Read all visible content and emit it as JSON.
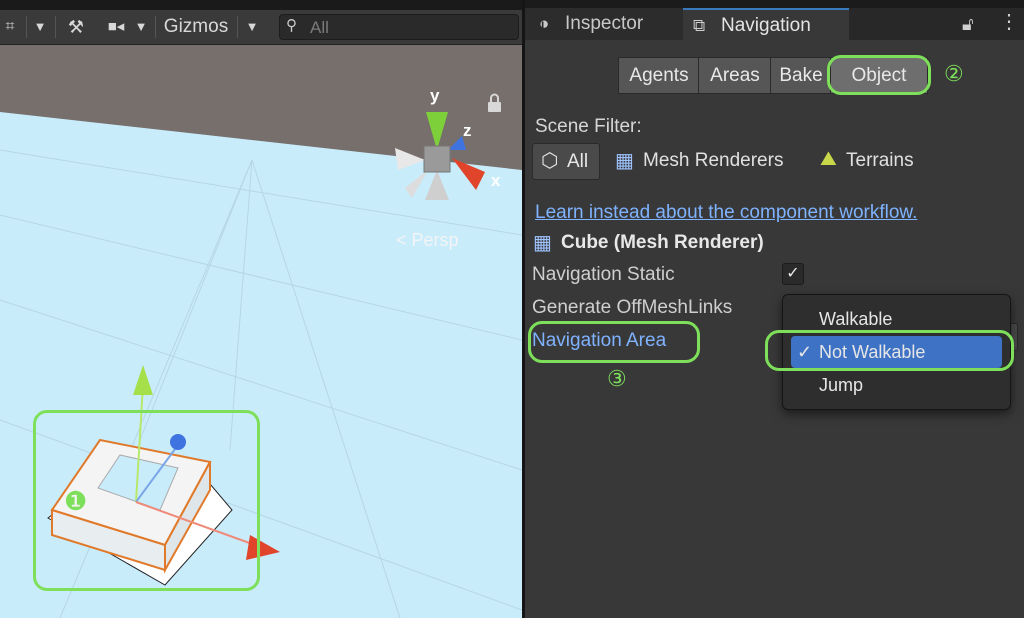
{
  "scene": {
    "toolbar": {
      "gizmos_label": "Gizmos",
      "search_placeholder": "All"
    },
    "persp_label": "< Persp",
    "axis_labels": {
      "x": "x",
      "y": "y",
      "z": "z"
    },
    "callout_number": "❶"
  },
  "panel": {
    "tabs": {
      "inspector": "Inspector",
      "navigation": "Navigation"
    },
    "segments": [
      "Agents",
      "Areas",
      "Bake",
      "Object"
    ],
    "callout_2": "②",
    "scene_filter": {
      "label": "Scene Filter:",
      "all": "All",
      "mesh_renderers": "Mesh Renderers",
      "terrains": "Terrains"
    },
    "learn_link": "Learn instead about the component workflow.",
    "object_title": "Cube (Mesh Renderer)",
    "navigation_static": {
      "label": "Navigation Static",
      "checked": true
    },
    "generate_offmeshlinks": "Generate OffMeshLinks",
    "navigation_area_label": "Navigation Area",
    "callout_3": "③",
    "area_options": [
      "Walkable",
      "Not Walkable",
      "Jump"
    ],
    "area_selected": "Not Walkable",
    "check_mark": "✓"
  },
  "colors": {
    "callout": "#7ee05a",
    "link": "#7fb2ff",
    "selected": "#3e72c4",
    "sky": "#c9ecfb",
    "horizon": "#776f6c"
  }
}
